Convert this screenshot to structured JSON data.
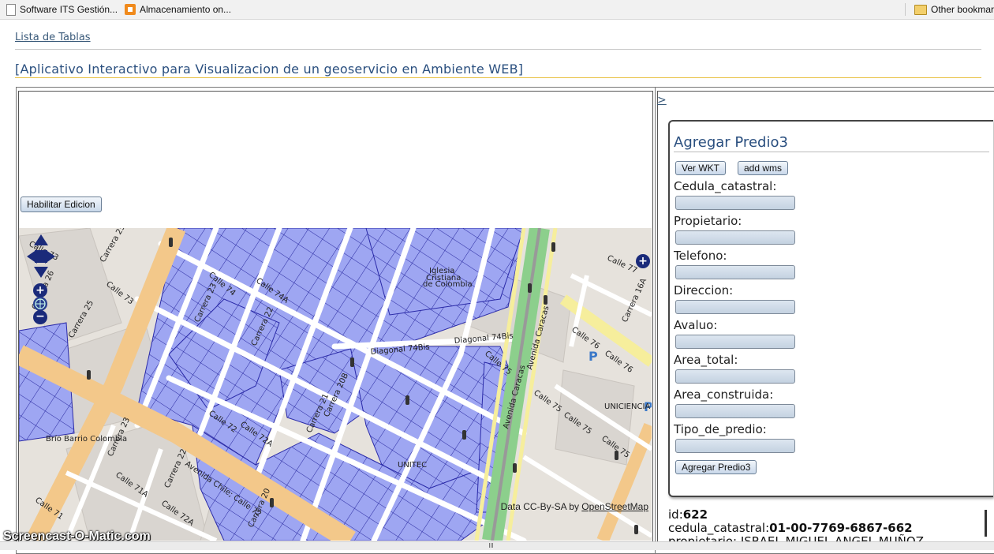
{
  "bookmarks": {
    "items": [
      {
        "label": "Software ITS Gestión...",
        "icon": "document-icon"
      },
      {
        "label": "Almacenamiento on...",
        "icon": "orange-square-icon"
      }
    ],
    "other": {
      "label": "Other bookmar",
      "icon": "folder-icon"
    }
  },
  "nav": {
    "tables_link": "Lista de Tablas"
  },
  "app": {
    "title": "[Aplicativo Interactivo para Visualizacion de un geoservicio en Ambiente WEB]"
  },
  "left": {
    "edit_button": "Habilitar Edicion"
  },
  "map": {
    "attribution_prefix": "Data CC-By-SA by ",
    "attribution_link": "OpenStreetMap",
    "labels": {
      "calle73a": "Calle 73",
      "calle73b": "Calle 73",
      "carrera25": "Carrera 25",
      "carrera26": "Carrera 26",
      "carrera25b": "Carrera 25",
      "calle74": "Calle 74",
      "calle74a": "Calle 74A",
      "carrera23": "Carrera 23",
      "iglesia": "Iglesia",
      "cristiana": "Cristiana",
      "decolombia": "de Colombia",
      "diagonal74bis": "Diagonal 74Bis",
      "diagonal74bis2": "Diagonal 74Bis",
      "calle75": "Calle 75",
      "calle76": "Calle 76",
      "calle76b": "Calle 76",
      "avcaracas": "Avenida Caracas",
      "avcaracas2": "Avenida Caracas",
      "carrera16a": "Carrera 16A",
      "calle77": "Calle 77",
      "calle75b": "Calle 75",
      "calle75c": "Calle 75",
      "calle75d": "Calle 75",
      "uniciencia": "UNICIENCIA",
      "unitec": "UNITEC",
      "barrio": "Brío Barrio Colombia",
      "avchile": "Avenida Chile; Calle 72",
      "calle72": "Calle 72",
      "calle71a": "Calle 71A",
      "calle71": "Calle 71",
      "calle72a": "Calle 72A",
      "carrera23b": "Carrera 23",
      "carrera22": "Carrera 22",
      "carrera20": "Carrera 20",
      "carrera20b": "Carrera 20B",
      "calle72b": "Calle 72A",
      "carrera21": "Carrera 21",
      "carrera22b": "Carrera 22"
    }
  },
  "right": {
    "expand_link": ">",
    "form": {
      "title": "Agregar Predio3",
      "ver_wkt": "Ver WKT",
      "add_wms": "add wms",
      "fields": [
        {
          "label": "Cedula_catastral:",
          "value": ""
        },
        {
          "label": "Propietario:",
          "value": ""
        },
        {
          "label": "Telefono:",
          "value": ""
        },
        {
          "label": "Direccion:",
          "value": ""
        },
        {
          "label": "Avaluo:",
          "value": ""
        },
        {
          "label": "Area_total:",
          "value": ""
        },
        {
          "label": "Area_construida:",
          "value": ""
        },
        {
          "label": "Tipo_de_predio:",
          "value": ""
        }
      ],
      "submit": "Agregar Predio3"
    },
    "info": {
      "id_label": "id:",
      "id_value": "622",
      "cedula_label": "cedula_catastral:",
      "cedula_value": "01-00-7769-6867-662",
      "prop_partial": "propietario: ISRAEL MIGUEL ANGEL MUÑOZ"
    }
  },
  "watermark": "Screencast-O-Matic.com",
  "colors": {
    "accent": "#2a4f7f",
    "parcel": "#9aa3f0",
    "parcel_border": "#2a2aa8",
    "road_major": "#f2c987",
    "road_green": "#8ccf8c"
  }
}
